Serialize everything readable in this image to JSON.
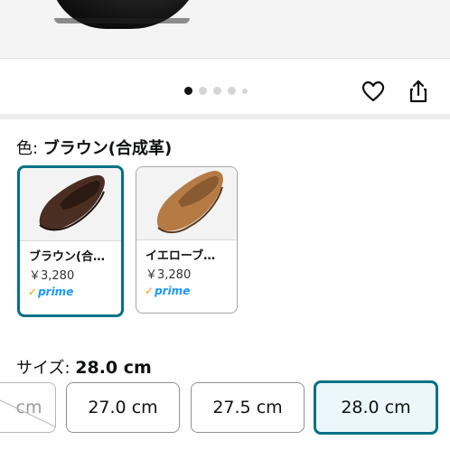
{
  "carousel": {
    "image_count": 5,
    "active_index": 0
  },
  "actions": {
    "favorite_icon": "heart-icon",
    "share_icon": "share-icon"
  },
  "color": {
    "label": "色: ",
    "selected": "ブラウン(合成革)",
    "options": [
      {
        "name": "ブラウン(合…",
        "price": "￥3,280",
        "prime": "prime",
        "selected": true
      },
      {
        "name": "イエローブ…",
        "price": "￥3,280",
        "prime": "prime",
        "selected": false
      }
    ]
  },
  "size": {
    "label": "サイズ: ",
    "selected": "28.0 cm",
    "options": [
      {
        "label": "cm",
        "available": false
      },
      {
        "label": "27.0 cm",
        "available": true
      },
      {
        "label": "27.5 cm",
        "available": true
      },
      {
        "label": "28.0 cm",
        "available": true,
        "selected": true
      }
    ]
  },
  "colors": {
    "accent": "#007185",
    "prime_blue": "#1a98ff",
    "prime_check": "#ff9900"
  }
}
